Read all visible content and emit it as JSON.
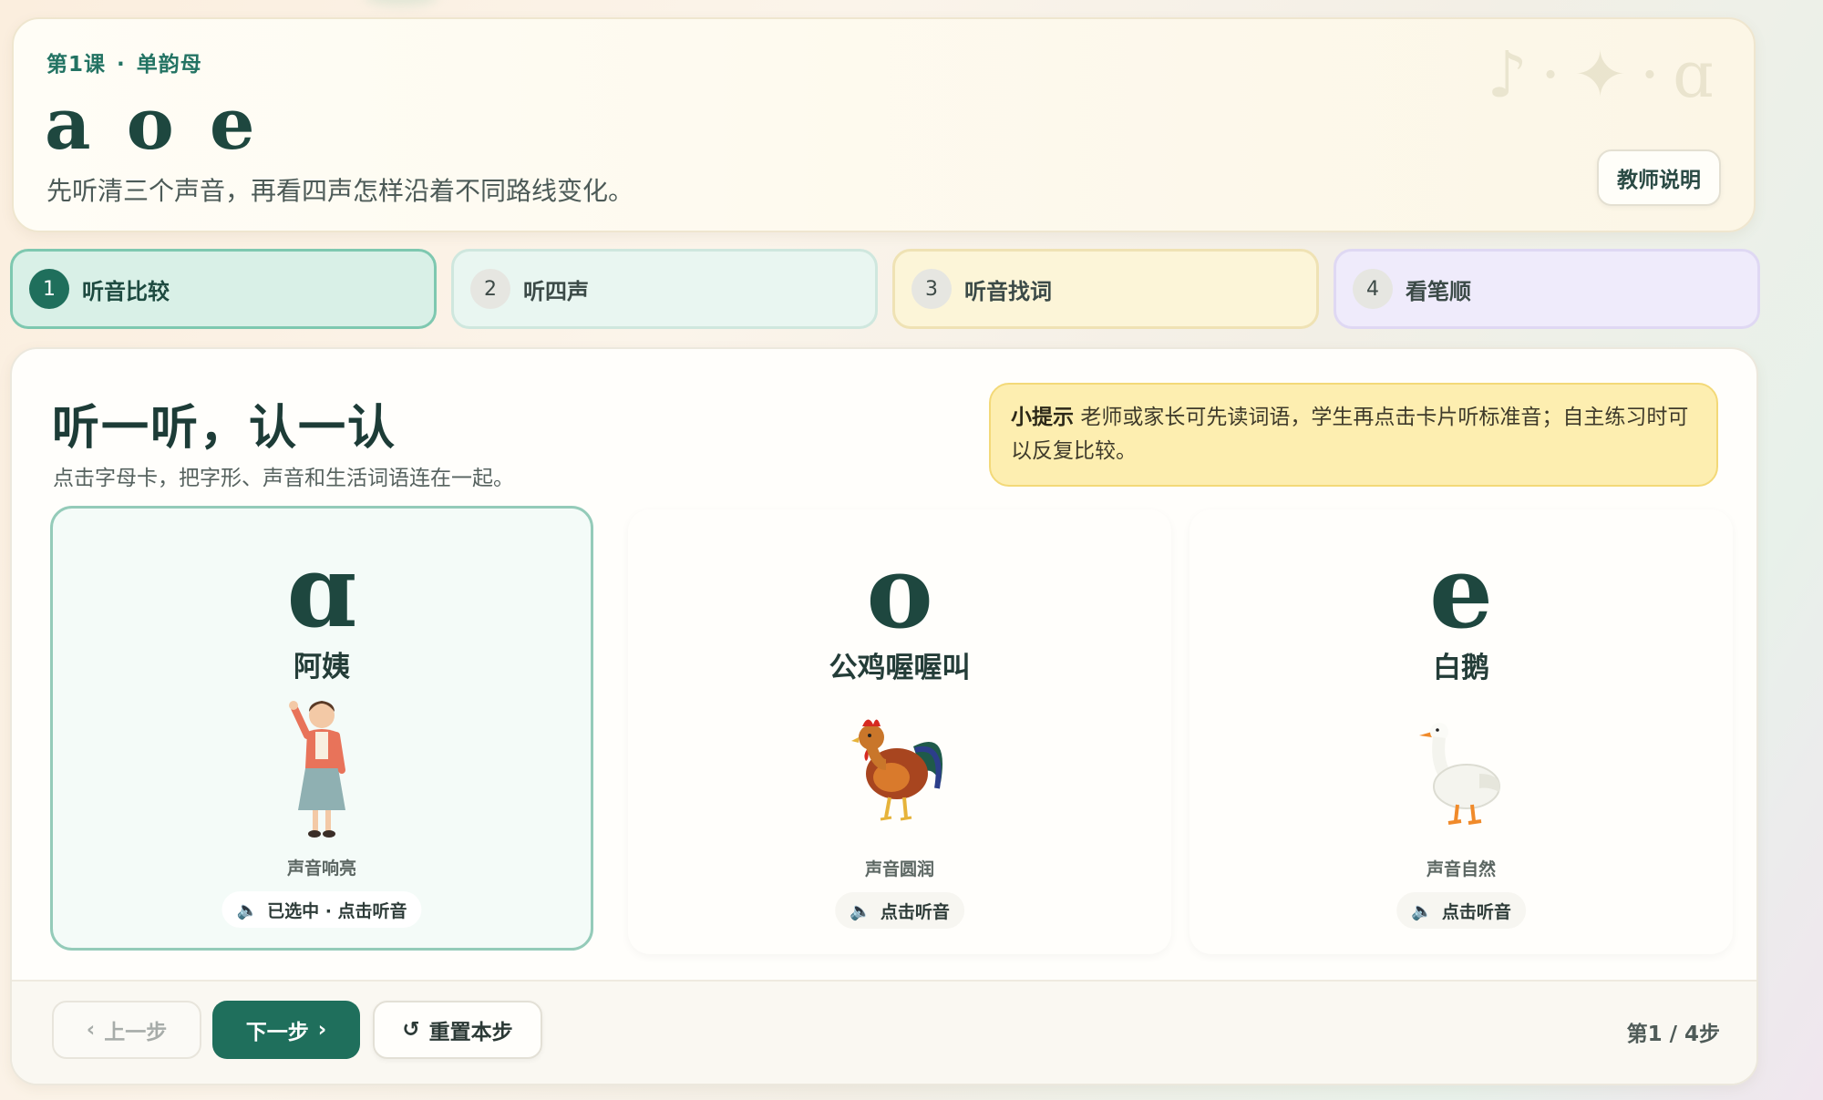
{
  "header": {
    "lesson": "第1课",
    "unit": "单韵母",
    "title": "a o e",
    "subtitle": "先听清三个声音，再看四声怎样沿着不同路线变化。",
    "teacher_button": "教师说明"
  },
  "steps": [
    {
      "num": "1",
      "label": "听音比较"
    },
    {
      "num": "2",
      "label": "听四声"
    },
    {
      "num": "3",
      "label": "听音找词"
    },
    {
      "num": "4",
      "label": "看笔顺"
    }
  ],
  "section": {
    "title": "听一听，认一认",
    "desc": "点击字母卡，把字形、声音和生活词语连在一起。",
    "tip_label": "小提示",
    "tip_text": "老师或家长可先读词语，学生再点击卡片听标准音；自主练习时可以反复比较。"
  },
  "cards": [
    {
      "letter": "ɑ",
      "word": "阿姨",
      "note": "声音响亮",
      "play": "已选中 · 点击听音",
      "picture": "woman-waving"
    },
    {
      "letter": "o",
      "word": "公鸡喔喔叫",
      "note": "声音圆润",
      "play": "点击听音",
      "picture": "rooster"
    },
    {
      "letter": "e",
      "word": "白鹅",
      "note": "声音自然",
      "play": "点击听音",
      "picture": "goose"
    }
  ],
  "footer": {
    "prev": "上一步",
    "next": "下一步",
    "reset": "重置本步",
    "progress": "第1 / 4步"
  },
  "colors": {
    "primary": "#1f6f5c",
    "tip_bg": "#fdeeb0"
  }
}
